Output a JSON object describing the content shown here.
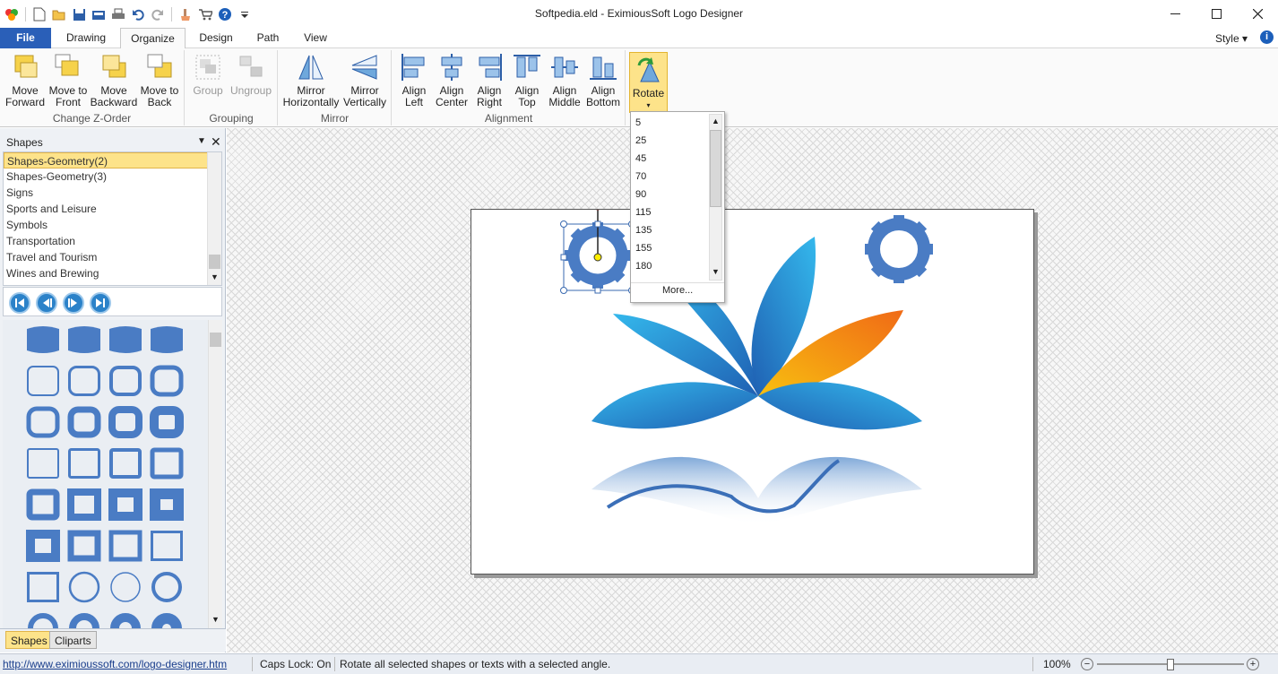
{
  "window": {
    "title": "Softpedia.eld - EximiousSoft Logo Designer",
    "minimize_icon": "minimize-icon",
    "maximize_icon": "maximize-icon",
    "close_icon": "close-icon"
  },
  "quick_access": [
    "app-icon",
    "new-icon",
    "open-icon",
    "save-icon",
    "save-as-icon",
    "print-icon",
    "undo-icon",
    "redo-icon",
    "clear-icon",
    "cart-icon",
    "help-icon",
    "dropdown-icon"
  ],
  "tabs": [
    {
      "label": "File"
    },
    {
      "label": "Drawing"
    },
    {
      "label": "Organize"
    },
    {
      "label": "Design"
    },
    {
      "label": "Path"
    },
    {
      "label": "View"
    }
  ],
  "style_label": "Style",
  "ribbon": {
    "change_zorder": {
      "label": "Change  Z-Order",
      "buttons": [
        {
          "line1": "Move",
          "line2": "Forward"
        },
        {
          "line1": "Move to",
          "line2": "Front"
        },
        {
          "line1": "Move",
          "line2": "Backward"
        },
        {
          "line1": "Move to",
          "line2": "Back"
        }
      ]
    },
    "grouping": {
      "label": "Grouping",
      "buttons": [
        {
          "line1": "Group"
        },
        {
          "line1": "Ungroup"
        }
      ]
    },
    "mirror": {
      "label": "Mirror",
      "buttons": [
        {
          "line1": "Mirror",
          "line2": "Horizontally"
        },
        {
          "line1": "Mirror",
          "line2": "Vertically"
        }
      ]
    },
    "alignment": {
      "label": "Alignment",
      "buttons": [
        {
          "line1": "Align",
          "line2": "Left"
        },
        {
          "line1": "Align",
          "line2": "Center"
        },
        {
          "line1": "Align",
          "line2": "Right"
        },
        {
          "line1": "Align",
          "line2": "Top"
        },
        {
          "line1": "Align",
          "line2": "Middle"
        },
        {
          "line1": "Align",
          "line2": "Bottom"
        }
      ]
    },
    "rotate": {
      "label": "Rotate"
    }
  },
  "rotate_menu": {
    "items": [
      "5",
      "25",
      "45",
      "70",
      "90",
      "115",
      "135",
      "155",
      "180"
    ],
    "more": "More..."
  },
  "panel": {
    "title": "Shapes",
    "categories": [
      "Shapes-Geometry(2)",
      "Shapes-Geometry(3)",
      "Signs",
      "Sports and Leisure",
      "Symbols",
      "Transportation",
      "Travel and Tourism",
      "Wines and Brewing"
    ],
    "tabs": [
      "Shapes",
      "Cliparts"
    ]
  },
  "status": {
    "url": "http://www.eximioussoft.com/logo-designer.htm",
    "caps": "Caps Lock: On",
    "message": "Rotate all selected shapes or texts with a selected angle.",
    "zoom": "100%"
  },
  "colors": {
    "accent": "#2a5fb8",
    "highlight": "#fde38a",
    "shape_blue": "#4a7cc4",
    "petal_orange": "#f07a16",
    "petal_yellow": "#f8c010"
  }
}
